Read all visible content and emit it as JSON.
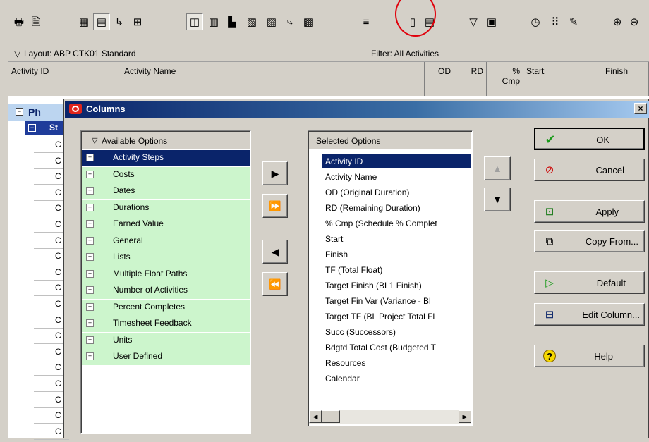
{
  "toolbar": {
    "icons": [
      "print-icon",
      "print-preview-icon",
      "table-icon",
      "table-split-icon",
      "tree-icon",
      "network-icon",
      "layout-icon",
      "bars-icon",
      "gantt-icon",
      "baseline-icon",
      "resource-icon",
      "logic-icon",
      "spreadsheet-icon",
      "timescale-icon",
      "columns-icon",
      "table-font-icon",
      "filter-icon",
      "group-sort-icon",
      "schedule-icon",
      "level-icon",
      "progress-icon",
      "zoom-in-icon",
      "zoom-out-icon"
    ]
  },
  "layout_bar": {
    "layout_label": "Layout: ABP CTK01 Standard",
    "filter_label": "Filter: All Activities"
  },
  "columns": {
    "activity_id": "Activity ID",
    "activity_name": "Activity Name",
    "od": "OD",
    "rd": "RD",
    "pct_top": "%",
    "pct_bottom": "Cmp",
    "start": "Start",
    "finish": "Finish"
  },
  "grid": {
    "phase_label": "Ph",
    "step_label": "St",
    "row_letter": "C"
  },
  "dialog": {
    "title": "Columns",
    "close_label": "×",
    "available_header": "Available Options",
    "available_options": [
      {
        "label": "Activity Steps",
        "selected": true
      },
      {
        "label": "Costs",
        "selected": false
      },
      {
        "label": "Dates",
        "selected": false
      },
      {
        "label": "Durations",
        "selected": false
      },
      {
        "label": "Earned Value",
        "selected": false
      },
      {
        "label": "General",
        "selected": false
      },
      {
        "label": "Lists",
        "selected": false
      },
      {
        "label": "Multiple Float Paths",
        "selected": false
      },
      {
        "label": "Number of Activities",
        "selected": false
      },
      {
        "label": "Percent Completes",
        "selected": false
      },
      {
        "label": "Timesheet Feedback",
        "selected": false
      },
      {
        "label": "Units",
        "selected": false
      },
      {
        "label": "User Defined",
        "selected": false
      }
    ],
    "selected_header": "Selected Options",
    "selected_options": [
      "Activity ID",
      "Activity Name",
      "OD  (Original Duration)",
      "RD  (Remaining Duration)",
      "% Cmp  (Schedule % Complet",
      "Start",
      "Finish",
      "TF  (Total Float)",
      "Target Finish  (BL1 Finish)",
      "Target Fin Var  (Variance - Bl",
      "Target TF  (BL Project Total Fl",
      "Succ  (Successors)",
      "Bdgtd Total Cost  (Budgeted T",
      "Resources",
      "Calendar"
    ],
    "buttons": {
      "ok": "OK",
      "cancel": "Cancel",
      "apply": "Apply",
      "copy_from": "Copy From...",
      "default": "Default",
      "edit_column": "Edit Column...",
      "help": "Help"
    }
  },
  "colors": {
    "selection": "#0a246a",
    "option_green": "#ccf5cc",
    "highlight_circle": "#e0000b"
  }
}
